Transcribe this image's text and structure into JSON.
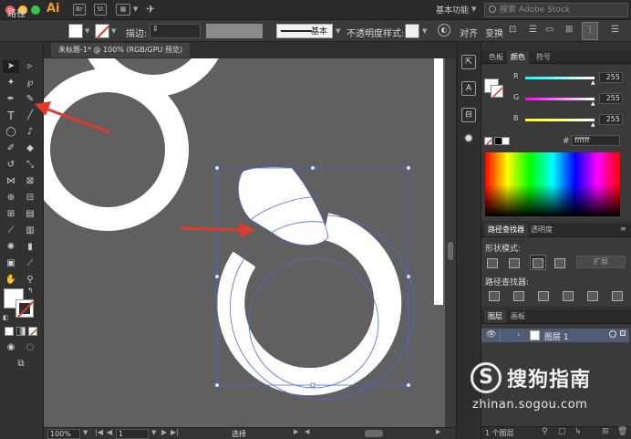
{
  "app": {
    "logo": "Ai",
    "workspace": "基本功能",
    "search_placeholder": "搜索 Adobe Stock"
  },
  "control_bar": {
    "object_type": "路径",
    "stroke_label": "描边:",
    "brush_label": "基本",
    "opacity_label": "不透明度",
    "style_label": "样式:",
    "align_label": "对齐",
    "transform_label": "变换"
  },
  "document": {
    "tab_title": "未标题-1* @ 100% (RGB/GPU 预览)"
  },
  "status_bar": {
    "zoom": "100%",
    "artboard": "1",
    "tool": "选择"
  },
  "color_panel": {
    "tabs": [
      "色板",
      "颜色",
      "符号"
    ],
    "active_tab": "颜色",
    "channels": [
      {
        "label": "R",
        "value": "255"
      },
      {
        "label": "G",
        "value": "255"
      },
      {
        "label": "B",
        "value": "255"
      }
    ],
    "hex_prefix": "#",
    "hex": "ffffff"
  },
  "pathfinder_panel": {
    "tabs": [
      "路径查找器",
      "透明度"
    ],
    "shape_modes_label": "形状模式:",
    "expand_label": "扩展",
    "pathfinders_label": "路径查找器:"
  },
  "layers_panel": {
    "tabs": [
      "图层",
      "画板"
    ],
    "layer_name": "图层 1",
    "count_label": "1 个图层"
  },
  "watermark": {
    "logo_char": "S",
    "name": "搜狗指南",
    "url": "zhinan.sogou.com"
  },
  "colors": {
    "accent_red": "#e3392a",
    "selection_blue": "#4a6bd8",
    "panel_bg": "#3a3a3a",
    "canvas_bg": "#606060"
  }
}
